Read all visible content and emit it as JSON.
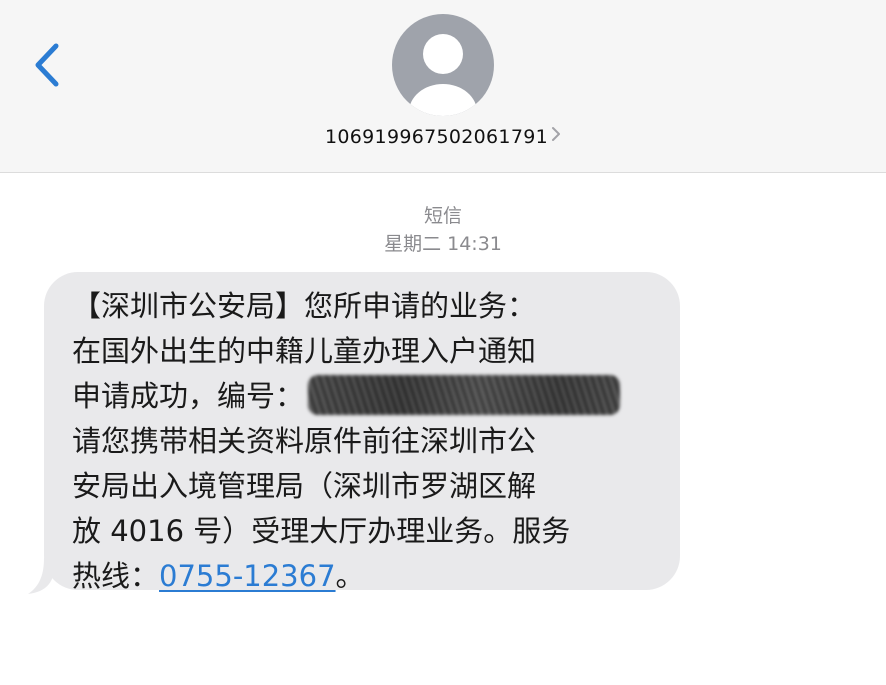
{
  "header": {
    "contact_number": "106919967502061791"
  },
  "meta": {
    "kind": "短信",
    "timestamp": "星期二 14:31"
  },
  "message": {
    "line1": "【深圳市公安局】您所申请的业务：",
    "line2": "在国外出生的中籍儿童办理入户通知",
    "line3_prefix": "申请成功，编号：",
    "line4": "请您携带相关资料原件前往深圳市公",
    "line5": "安局出入境管理局（深圳市罗湖区解",
    "line6": "放 4016 号）受理大厅办理业务。服务",
    "line7_prefix": "热线：",
    "hotline": "0755-12367",
    "line7_suffix": "。"
  },
  "colors": {
    "header_bg": "#f6f6f6",
    "accent_blue": "#2b7cd3",
    "bubble_bg": "#e9e9eb",
    "meta_gray": "#8a8a8e",
    "avatar_gray": "#9fa3ab"
  },
  "icons": {
    "back": "chevron-left-icon",
    "avatar": "person-icon",
    "details": "chevron-right-icon"
  }
}
